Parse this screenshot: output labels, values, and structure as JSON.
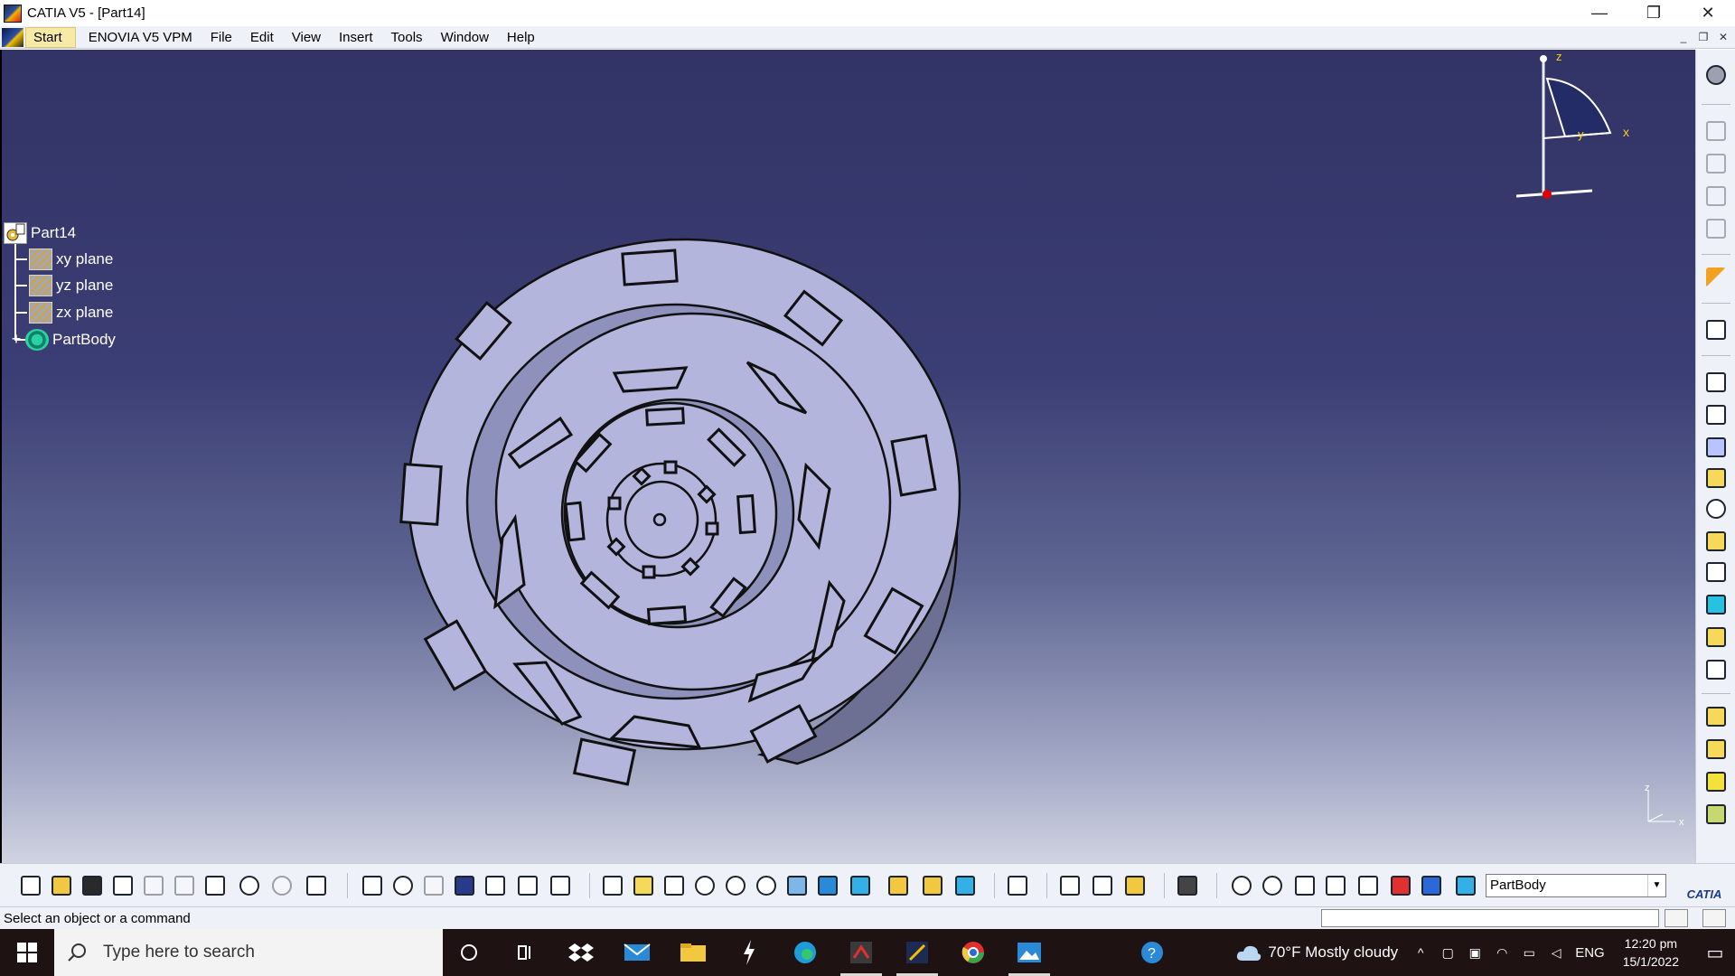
{
  "window": {
    "title": "CATIA V5 - [Part14]",
    "controls": {
      "minimize": "—",
      "restore": "❐",
      "close": "✕"
    }
  },
  "menubar": {
    "items": [
      "Start",
      "ENOVIA V5 VPM",
      "File",
      "Edit",
      "View",
      "Insert",
      "Tools",
      "Window",
      "Help"
    ],
    "mdi": {
      "minimize": "_",
      "restore": "❐",
      "close": "✕"
    }
  },
  "tree": {
    "root": "Part14",
    "children": [
      "xy plane",
      "yz plane",
      "zx plane",
      "PartBody"
    ]
  },
  "compass": {
    "z": "z",
    "x": "x",
    "y": "y"
  },
  "mini_axis": {
    "z": "z",
    "x": "x"
  },
  "toolbar": {
    "current_body": "PartBody",
    "brand": "CATIA"
  },
  "status": {
    "message": "Select an object or a command"
  },
  "taskbar": {
    "search_placeholder": "Type here to search",
    "weather": "70°F  Mostly cloudy",
    "language": "ENG",
    "time": "12:20 pm",
    "date": "15/1/2022"
  },
  "colors": {
    "viewport_top": "#323366",
    "viewport_bottom": "#d0d3e0",
    "part_fill": "#b4b5dc",
    "part_edge": "#111111",
    "taskbar": "#1f1213"
  }
}
